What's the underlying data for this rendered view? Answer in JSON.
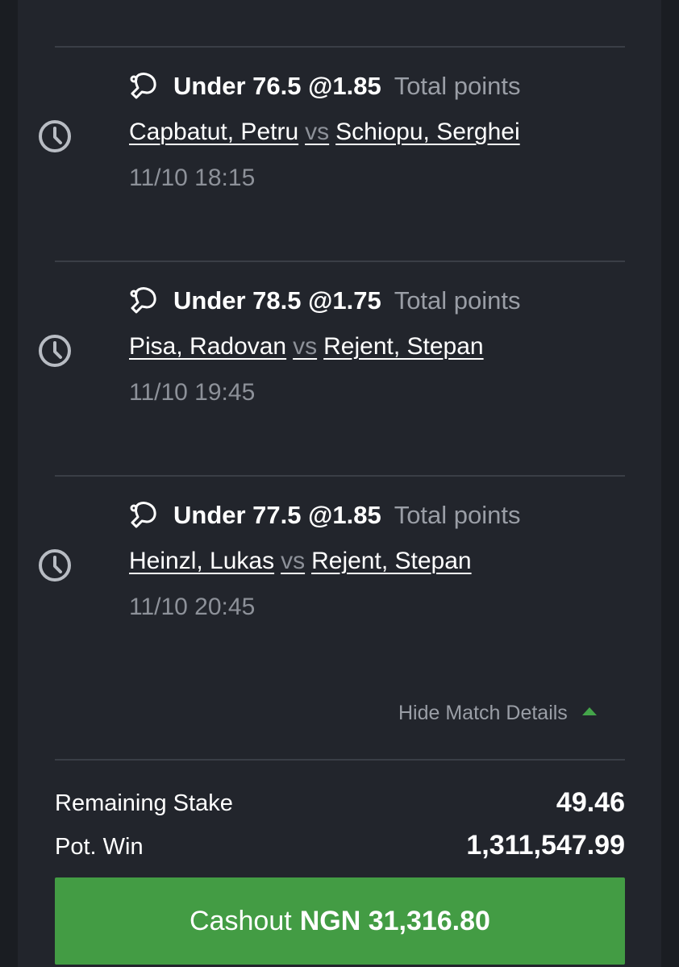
{
  "bets": [
    {
      "selection": "Under 76.5 @1.85",
      "market_type": "Total points",
      "home": "Capbatut, Petru",
      "vs": "vs",
      "away": "Schiopu, Serghei",
      "datetime": "11/10 18:15"
    },
    {
      "selection": "Under 78.5 @1.75",
      "market_type": "Total points",
      "home": "Pisa, Radovan",
      "vs": "vs",
      "away": "Rejent, Stepan",
      "datetime": "11/10 19:45"
    },
    {
      "selection": "Under 77.5 @1.85",
      "market_type": "Total points",
      "home": "Heinzl, Lukas",
      "vs": "vs",
      "away": "Rejent, Stepan",
      "datetime": "11/10 20:45"
    }
  ],
  "hide_details_label": "Hide Match Details",
  "summary": {
    "remaining_stake_label": "Remaining Stake",
    "remaining_stake_value": "49.46",
    "pot_win_label": "Pot. Win",
    "pot_win_value": "1,311,547.99"
  },
  "cashout": {
    "label": "Cashout",
    "amount": "NGN 31,316.80"
  },
  "colors": {
    "background": "#22252c",
    "accent_green": "#439c44",
    "muted_text": "#9a9ea6"
  },
  "icons": {
    "sport": "table-tennis-icon",
    "time": "clock-icon",
    "toggle": "caret-up-icon"
  }
}
